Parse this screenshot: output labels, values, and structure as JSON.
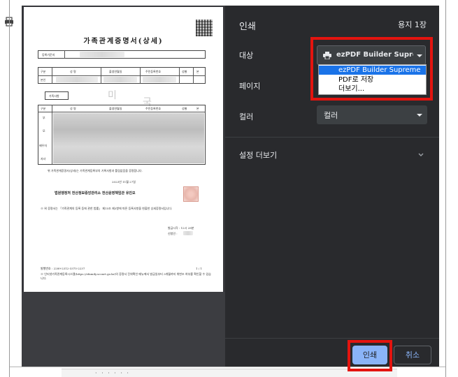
{
  "print_panel": {
    "title": "인쇄",
    "page_count": "용지 1장",
    "destination": {
      "label": "대상",
      "selected": "ezPDF Builder Supreme",
      "options": [
        "ezPDF Builder Supreme",
        "PDF로 저장",
        "더보기..."
      ]
    },
    "pages_label": "페이지",
    "color": {
      "label": "컬러",
      "value": "컬러"
    },
    "more_settings_label": "설정 더보기",
    "print_button": "인쇄",
    "cancel_button": "취소"
  },
  "document": {
    "title": "가족관계증명서(상세)",
    "registry_label": "등록기준지",
    "table_headers": [
      "구분",
      "성 명",
      "출생연월일",
      "주민등록번호",
      "성별",
      "본"
    ],
    "self_label": "본인",
    "family_section_label": "가족사항",
    "family_rows": [
      "부",
      "모",
      "배우자",
      "자녀"
    ],
    "certification": "위 가족관계증명서(상세)는 가족관계등록부의 기록사항과 틀림없음을 증명합니다.",
    "date": "2023년 11월 27일",
    "issuer": "법원행정처 전산정보중앙관리소 전산운영책임관 유진오",
    "notice": "※ 위 증명서는 「가족관계의 등록 등에 관한 법률」 제15조 제3항에 따른 등록사항을 현출한 상세증명서입니다.",
    "fee": "발급시각 : 12시 28분",
    "issued_by": "신청인 :",
    "issue_number": "발행번호 : 2289-2312-3375-2237",
    "page_num": "1 / 1",
    "footer_note": "※ 인터넷가족관계등록시스템(https://efamily.scourt.go.kr)의 증명서 진위확인 메뉴에서 발급일부터 3개월까지 위변조 여부를 확인할 수 있습니다.",
    "watermark_chars": [
      "미",
      "국"
    ]
  },
  "underlay": {
    "bottom_text": "· · · · · ·"
  },
  "colors": {
    "panel_bg": "#292a2d",
    "highlight": "#e3140f",
    "accent": "#8ab4f8",
    "selected_option": "#1a73e8"
  }
}
